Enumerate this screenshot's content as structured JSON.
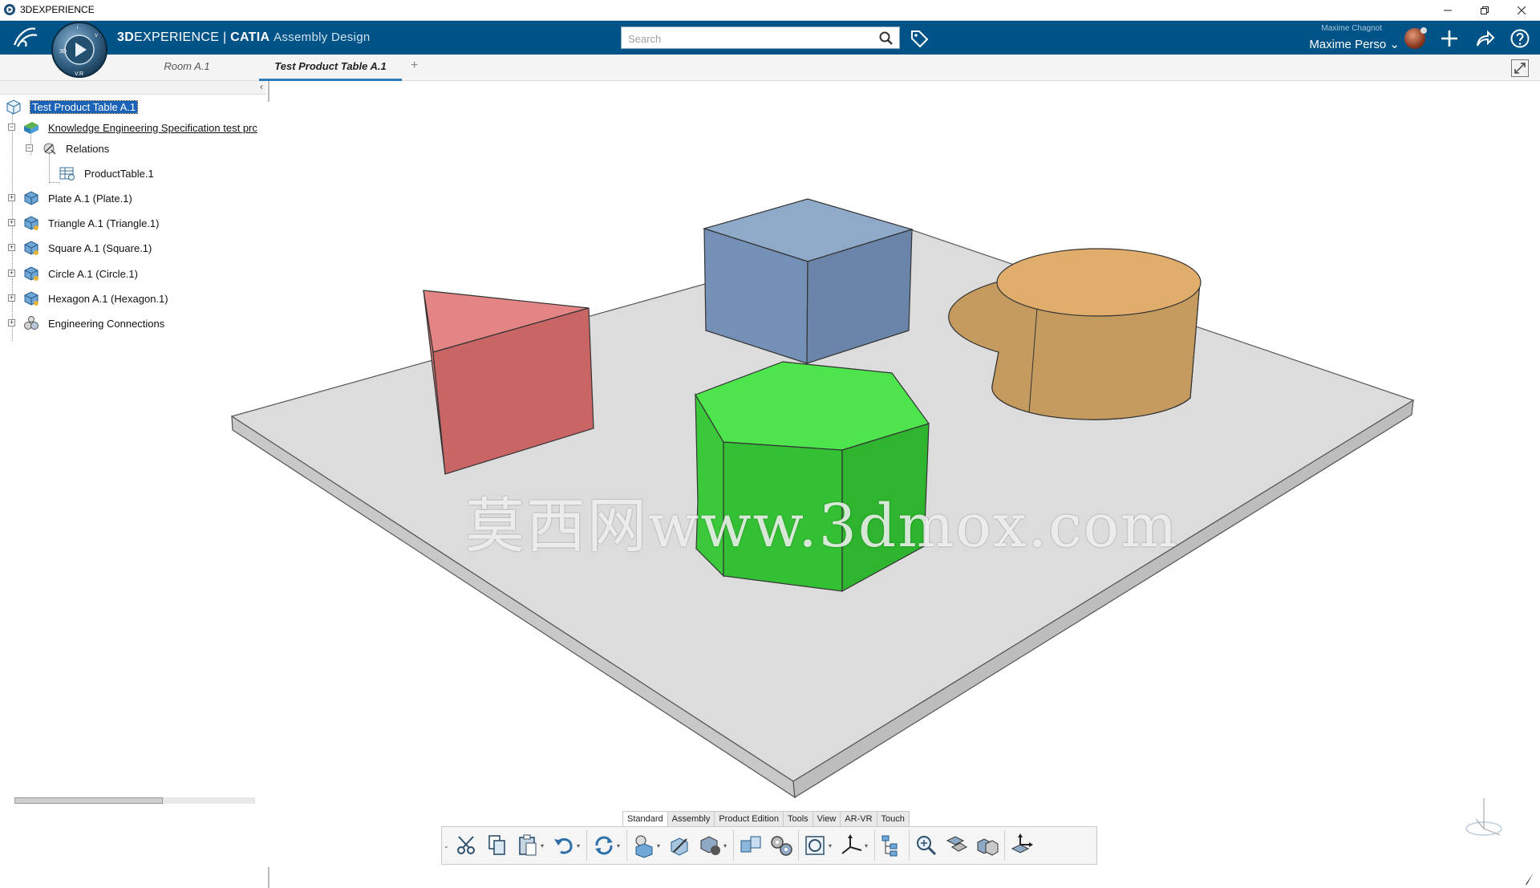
{
  "window": {
    "title": "3DEXPERIENCE"
  },
  "topbar": {
    "brand_prefix": "3D",
    "brand_main": "EXPERIENCE",
    "brand_sep": " | ",
    "brand_product": "CATIA",
    "brand_app": "Assembly Design",
    "search_placeholder": "Search",
    "user_sub": "Maxime Chagnot",
    "user_name": "Maxime Perso"
  },
  "tabs": [
    {
      "label": "Room A.1",
      "active": false
    },
    {
      "label": "Test Product Table A.1",
      "active": true
    }
  ],
  "tree": {
    "root": "Test Product Table A.1",
    "nodes": [
      {
        "label": "Knowledge Engineering Specification test prc"
      },
      {
        "label": "Relations"
      },
      {
        "label": "ProductTable.1"
      },
      {
        "label": "Plate A.1 (Plate.1)"
      },
      {
        "label": "Triangle A.1 (Triangle.1)"
      },
      {
        "label": "Square A.1 (Square.1)"
      },
      {
        "label": "Circle A.1 (Circle.1)"
      },
      {
        "label": "Hexagon A.1 (Hexagon.1)"
      },
      {
        "label": "Engineering Connections"
      }
    ]
  },
  "viewport": {
    "watermark": "莫西网www.3dmox.com",
    "colors": {
      "plate": "#dcdcdc",
      "cube": "#7f9ec3",
      "prism": "#d96b6b",
      "cylinder": "#e0ad6c",
      "hexagon": "#3fd43f"
    }
  },
  "action_sections": [
    "Standard",
    "Assembly",
    "Product Edition",
    "Tools",
    "View",
    "AR-VR",
    "Touch"
  ],
  "action_tools": [
    "cut-icon",
    "copy-icon",
    "paste-icon",
    "undo-icon",
    "update-icon",
    "insert-product-icon",
    "replace-icon",
    "existing-component-icon",
    "explode-icon",
    "gears-icon",
    "section-icon",
    "axis-system-icon",
    "structure-icon",
    "zoom-icon",
    "collapse-icon",
    "clash-icon",
    "move-icon"
  ],
  "accent": "#005386"
}
